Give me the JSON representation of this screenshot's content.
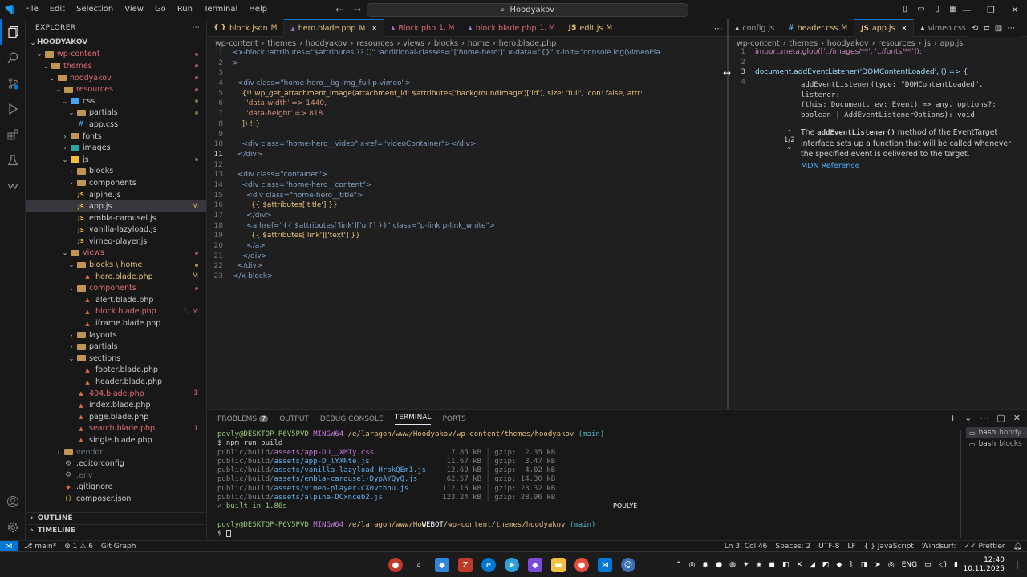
{
  "menu": [
    "File",
    "Edit",
    "Selection",
    "View",
    "Go",
    "Run",
    "Terminal",
    "Help"
  ],
  "search": {
    "text": "Hoodyakov"
  },
  "explorer": {
    "title": "EXPLORER",
    "root": "HOODYAKOV",
    "items": [
      {
        "label": "wp-content",
        "color": "#e06c75",
        "type": "folder",
        "open": true,
        "depth": 1,
        "dot": true
      },
      {
        "label": "themes",
        "color": "#e06c75",
        "type": "folder",
        "open": true,
        "depth": 2,
        "dot": true
      },
      {
        "label": "hoodyakov",
        "color": "#e06c75",
        "type": "folder",
        "open": true,
        "depth": 3,
        "dot": true
      },
      {
        "label": "resources",
        "color": "#e06c75",
        "type": "folder",
        "open": true,
        "depth": 4,
        "dot": true
      },
      {
        "label": "css",
        "color": "#cccccc",
        "type": "folder-css",
        "open": true,
        "depth": 5,
        "dot": true
      },
      {
        "label": "partials",
        "color": "#cccccc",
        "type": "folder",
        "open": true,
        "depth": 6,
        "dot": true
      },
      {
        "label": "app.css",
        "color": "#cccccc",
        "type": "css",
        "depth": 6
      },
      {
        "label": "fonts",
        "color": "#cccccc",
        "type": "folder",
        "open": false,
        "depth": 5
      },
      {
        "label": "images",
        "color": "#cccccc",
        "type": "folder-img",
        "open": false,
        "depth": 5
      },
      {
        "label": "js",
        "color": "#cccccc",
        "type": "folder-js",
        "open": true,
        "depth": 5,
        "dot": true
      },
      {
        "label": "blocks",
        "color": "#cccccc",
        "type": "folder",
        "open": false,
        "depth": 6
      },
      {
        "label": "components",
        "color": "#cccccc",
        "type": "folder",
        "open": false,
        "depth": 6
      },
      {
        "label": "alpine.js",
        "color": "#cccccc",
        "type": "js",
        "depth": 6
      },
      {
        "label": "app.js",
        "color": "#cccccc",
        "type": "js",
        "depth": 6,
        "badge": "M",
        "selected": true
      },
      {
        "label": "embla-carousel.js",
        "color": "#cccccc",
        "type": "js",
        "depth": 6
      },
      {
        "label": "vanilla-lazyload.js",
        "color": "#cccccc",
        "type": "js",
        "depth": 6
      },
      {
        "label": "vimeo-player.js",
        "color": "#cccccc",
        "type": "js",
        "depth": 6
      },
      {
        "label": "views",
        "color": "#e06c75",
        "type": "folder",
        "open": true,
        "depth": 5,
        "dot": true
      },
      {
        "label": "blocks \\ home",
        "color": "#e5c07b",
        "type": "folder",
        "open": true,
        "depth": 6,
        "dot": true
      },
      {
        "label": "hero.blade.php",
        "color": "#e5c07b",
        "type": "php",
        "depth": 7,
        "badge": "M"
      },
      {
        "label": "components",
        "color": "#e06c75",
        "type": "folder",
        "open": true,
        "depth": 6,
        "dot": true
      },
      {
        "label": "alert.blade.php",
        "color": "#cccccc",
        "type": "php",
        "depth": 7
      },
      {
        "label": "block.blade.php",
        "color": "#e06c75",
        "type": "php",
        "depth": 7,
        "badge": "1, M"
      },
      {
        "label": "iframe.blade.php",
        "color": "#cccccc",
        "type": "php",
        "depth": 7
      },
      {
        "label": "layouts",
        "color": "#cccccc",
        "type": "folder",
        "open": false,
        "depth": 6
      },
      {
        "label": "partials",
        "color": "#cccccc",
        "type": "folder",
        "open": false,
        "depth": 6
      },
      {
        "label": "sections",
        "color": "#cccccc",
        "type": "folder",
        "open": true,
        "depth": 6
      },
      {
        "label": "footer.blade.php",
        "color": "#cccccc",
        "type": "php",
        "depth": 7
      },
      {
        "label": "header.blade.php",
        "color": "#cccccc",
        "type": "php",
        "depth": 7
      },
      {
        "label": "404.blade.php",
        "color": "#e06c75",
        "type": "php",
        "depth": 6,
        "badge": "1"
      },
      {
        "label": "index.blade.php",
        "color": "#cccccc",
        "type": "php",
        "depth": 6
      },
      {
        "label": "page.blade.php",
        "color": "#cccccc",
        "type": "php",
        "depth": 6
      },
      {
        "label": "search.blade.php",
        "color": "#e06c75",
        "type": "php",
        "depth": 6,
        "badge": "1"
      },
      {
        "label": "single.blade.php",
        "color": "#cccccc",
        "type": "php",
        "depth": 6
      },
      {
        "label": "vendor",
        "color": "#6e7681",
        "type": "folder",
        "open": false,
        "depth": 4
      },
      {
        "label": ".editorconfig",
        "color": "#cccccc",
        "type": "gear",
        "depth": 4
      },
      {
        "label": ".env",
        "color": "#6e7681",
        "type": "gear",
        "depth": 4
      },
      {
        "label": ".gitignore",
        "color": "#cccccc",
        "type": "git",
        "depth": 4
      },
      {
        "label": "composer.json",
        "color": "#cccccc",
        "type": "json",
        "depth": 4
      }
    ],
    "outline": "OUTLINE",
    "timeline": "TIMELINE"
  },
  "tabs_left": [
    {
      "icon": "{ }",
      "iconColor": "#e5c07b",
      "label": "block.json",
      "mod": "M",
      "color": "#e5c07b"
    },
    {
      "icon": "",
      "iconColor": "#a074c4",
      "label": "hero.blade.php",
      "mod": "M",
      "color": "#e5c07b",
      "active": true
    },
    {
      "icon": "",
      "iconColor": "#a074c4",
      "label": "Block.php",
      "mod": "1, M",
      "color": "#e06c75"
    },
    {
      "icon": "",
      "iconColor": "#a074c4",
      "label": "block.blade.php",
      "mod": "1, M",
      "color": "#e06c75"
    },
    {
      "icon": "JS",
      "iconColor": "#e5c07b",
      "label": "edit.js",
      "mod": "M",
      "color": "#e5c07b"
    }
  ],
  "breadcrumb_left": [
    "wp-content",
    "themes",
    "hoodyakov",
    "resources",
    "views",
    "blocks",
    "home",
    "hero.blade.php"
  ],
  "tabs_right": [
    {
      "icon": "",
      "iconColor": "#cccccc",
      "label": "config.js",
      "mod": "",
      "color": "#9d9d9d"
    },
    {
      "icon": "#",
      "iconColor": "#61afef",
      "label": "header.css",
      "mod": "M",
      "color": "#e5c07b"
    },
    {
      "icon": "JS",
      "iconColor": "#e5c07b",
      "label": "app.js",
      "mod": "",
      "color": "#e5c07b",
      "active": true
    },
    {
      "icon": "",
      "iconColor": "#cccccc",
      "label": "vimeo.css",
      "mod": "",
      "color": "#9d9d9d"
    }
  ],
  "breadcrumb_right": [
    "wp-content",
    "themes",
    "hoodyakov",
    "resources",
    "js",
    "app.js"
  ],
  "code_left": [
    {
      "n": "1",
      "t": "<x-block :attributes=\"$attributes ?? []\" :additional-classes=\"['home-hero']\" x-data=\"{}\" x-init=\"console.log(vimeoPla"
    },
    {
      "n": "2",
      "t": ">"
    },
    {
      "n": "3",
      "t": ""
    },
    {
      "n": "4",
      "t": "  <div class=\"home-hero__bg img_full p-vimeo\">"
    },
    {
      "n": "5",
      "t": "    {!! wp_get_attachment_image(attachment_id: $attributes['backgroundImage']['id'], size: 'full', icon: false, attr:"
    },
    {
      "n": "6",
      "t": "      'data-width' => 1440,"
    },
    {
      "n": "7",
      "t": "      'data-height' => 818"
    },
    {
      "n": "8",
      "t": "    ]) !!}"
    },
    {
      "n": "9",
      "t": ""
    },
    {
      "n": "10",
      "t": "    <div class=\"home-hero__video\" x-ref=\"videoContainer\"></div>"
    },
    {
      "n": "11",
      "t": "  </div>"
    },
    {
      "n": "12",
      "t": ""
    },
    {
      "n": "13",
      "t": "  <div class=\"container\">"
    },
    {
      "n": "14",
      "t": "    <div class=\"home-hero__content\">"
    },
    {
      "n": "15",
      "t": "      <div class=\"home-hero__title\">"
    },
    {
      "n": "16",
      "t": "        {{ $attributes['title'] }}"
    },
    {
      "n": "17",
      "t": "      </div>"
    },
    {
      "n": "18",
      "t": "      <a href=\"{{ $attributes['link']['url'] }}\" class=\"p-link p-link_white\">"
    },
    {
      "n": "19",
      "t": "        {{ $attributes['link']['text'] }}"
    },
    {
      "n": "20",
      "t": "      </a>"
    },
    {
      "n": "21",
      "t": "    </div>"
    },
    {
      "n": "22",
      "t": "  </div>"
    },
    {
      "n": "23",
      "t": "</x-block>"
    }
  ],
  "code_left_lines": [
    "1",
    "2",
    "3",
    "4",
    "5",
    "6",
    "7",
    "8",
    "",
    "9",
    "10",
    "11",
    "12",
    "13",
    "14",
    "15",
    "16",
    "17",
    "18",
    "19",
    "20",
    "21",
    "22",
    "23"
  ],
  "code_right": [
    {
      "n": "1",
      "t": "import.meta.glob(['../images/**', '../fonts/**']);"
    },
    {
      "n": "2",
      "t": ""
    },
    {
      "n": "3",
      "t": "document.addEventListener('DOMContentLoaded', () => {"
    },
    {
      "n": "4",
      "t": ""
    }
  ],
  "hover": {
    "signature1": "addEventListener(type: \"DOMContentLoaded\", listener:",
    "signature2": "(this: Document, ev: Event) => any, options?:",
    "signature3": "boolean | AddEventListenerOptions): void",
    "desc_pre": "The ",
    "desc_code": "addEventListener()",
    "desc_post": " method of the EventTarget interface sets up a function that will be called whenever the specified event is delivered to the target.",
    "counter": "1/2",
    "link": "MDN Reference"
  },
  "panel": {
    "tabs": [
      "PROBLEMS",
      "OUTPUT",
      "DEBUG CONSOLE",
      "TERMINAL",
      "PORTS"
    ],
    "problems_count": "7",
    "active_tab": "TERMINAL",
    "prompt_user": "povly@DESKTOP-P6V5PVD",
    "prompt_sys": "MINGW64",
    "prompt_path": "/e/laragon/www/Hoodyakov/wp-content/themes/hoodyakov",
    "prompt_path2": "/e/laragon/www/Ho",
    "prompt_path2_rest": "/wp-content/themes/hoodyakov",
    "prompt_branch": "(main)",
    "command": "$ npm run build",
    "build_rows": [
      {
        "dir": "public/build/",
        "file": "assets/app-DU__XMTy.css",
        "size": "7.85 kB",
        "gzip": "gzip:  2.35 kB",
        "color": "#c678dd"
      },
      {
        "dir": "public/build/",
        "file": "assets/app-D_lYXNte.js",
        "size": "11.67 kB",
        "gzip": "gzip:  3.47 kB",
        "color": "#61afef"
      },
      {
        "dir": "public/build/",
        "file": "assets/vanilla-lazyload-HrpkQEm1.js",
        "size": "12.69 kB",
        "gzip": "gzip:  4.02 kB",
        "color": "#61afef"
      },
      {
        "dir": "public/build/",
        "file": "assets/embla-carousel-DypAYQyQ.js",
        "size": "62.57 kB",
        "gzip": "gzip: 14.30 kB",
        "color": "#61afef"
      },
      {
        "dir": "public/build/",
        "file": "assets/vimeo-player-CX0vthhu.js",
        "size": "112.18 kB",
        "gzip": "gzip: 23.32 kB",
        "color": "#61afef"
      },
      {
        "dir": "public/build/",
        "file": "assets/alpine-DCxnceb2.js",
        "size": "123.24 kB",
        "gzip": "gzip: 28.96 kB",
        "color": "#61afef"
      }
    ],
    "built": "✓ built in 1.86s",
    "overlay1": "WEBOT",
    "overlay2": "POULYE",
    "terminals": [
      {
        "label": "bash",
        "sub": "hoody...",
        "active": true
      },
      {
        "label": "bash",
        "sub": "blocks"
      }
    ]
  },
  "status": {
    "branch": "main*",
    "errors": "1",
    "warnings": "6",
    "git_graph": "Git Graph",
    "position": "Ln 3, Col 46",
    "spaces": "Spaces: 2",
    "encoding": "UTF-8",
    "eol": "LF",
    "language": "JavaScript",
    "windsurf": "Windsurf:",
    "prettier": "Prettier"
  },
  "taskbar": {
    "lang": "ENG",
    "time": "12:40",
    "date": "10.11.2025"
  }
}
